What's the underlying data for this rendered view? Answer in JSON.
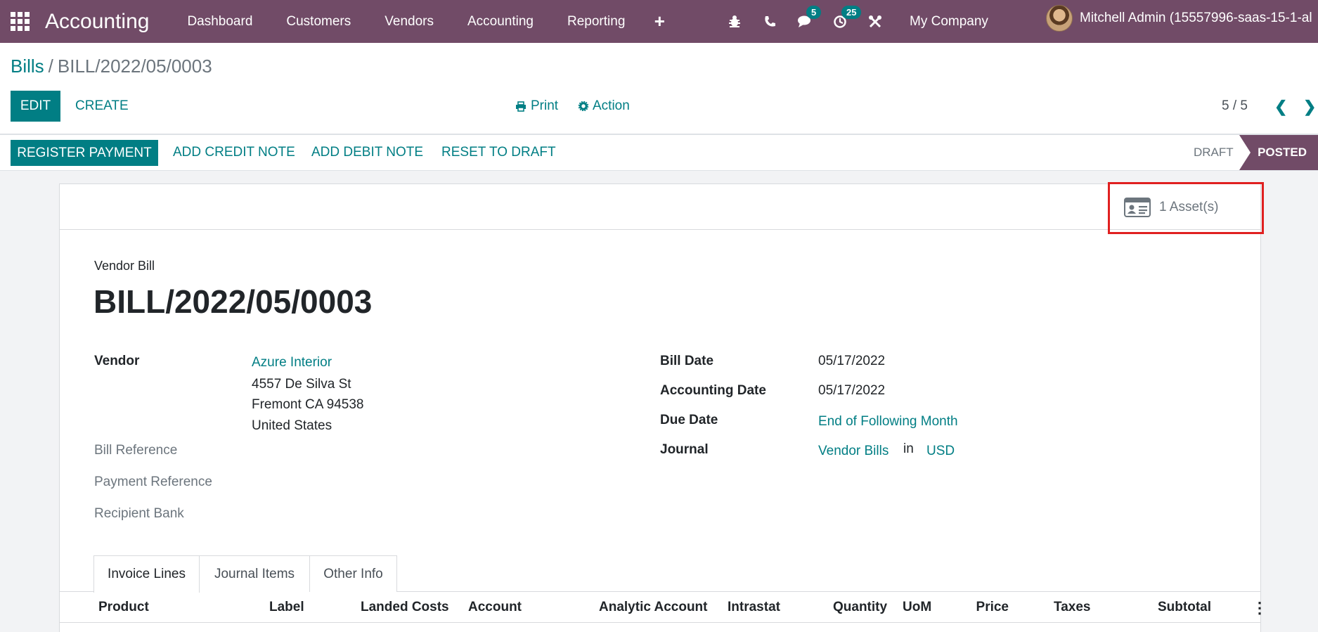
{
  "navbar": {
    "app_name": "Accounting",
    "menu": [
      "Dashboard",
      "Customers",
      "Vendors",
      "Accounting",
      "Reporting"
    ],
    "messages_count": "5",
    "activities_count": "25",
    "company": "My Company",
    "user": "Mitchell Admin (15557996-saas-15-1-al"
  },
  "breadcrumb": {
    "parent": "Bills",
    "separator": "/",
    "current": "BILL/2022/05/0003"
  },
  "control": {
    "edit": "EDIT",
    "create": "CREATE",
    "print": "Print",
    "action": "Action",
    "pager": "5 / 5"
  },
  "statusbar": {
    "register_payment": "REGISTER PAYMENT",
    "add_credit_note": "ADD CREDIT NOTE",
    "add_debit_note": "ADD DEBIT NOTE",
    "reset_to_draft": "RESET TO DRAFT",
    "stages": {
      "draft": "DRAFT",
      "posted": "POSTED"
    },
    "active_stage": "POSTED"
  },
  "smart_button": {
    "assets": "1 Asset(s)"
  },
  "document": {
    "type": "Vendor Bill",
    "name": "BILL/2022/05/0003"
  },
  "fields": {
    "vendor_label": "Vendor",
    "vendor_name": "Azure Interior",
    "vendor_street": "4557 De Silva St",
    "vendor_city": "Fremont CA 94538",
    "vendor_country": "United States",
    "bill_reference_label": "Bill Reference",
    "payment_reference_label": "Payment Reference",
    "recipient_bank_label": "Recipient Bank",
    "bill_date_label": "Bill Date",
    "bill_date": "05/17/2022",
    "accounting_date_label": "Accounting Date",
    "accounting_date": "05/17/2022",
    "due_date_label": "Due Date",
    "due_date": "End of Following Month",
    "journal_label": "Journal",
    "journal": "Vendor Bills",
    "journal_in": "in",
    "currency": "USD"
  },
  "tabs": [
    "Invoice Lines",
    "Journal Items",
    "Other Info"
  ],
  "active_tab": "Invoice Lines",
  "columns": [
    "Product",
    "Label",
    "Landed Costs",
    "Account",
    "Analytic Account",
    "Intrastat",
    "Quantity",
    "UoM",
    "Price",
    "Taxes",
    "Subtotal"
  ]
}
